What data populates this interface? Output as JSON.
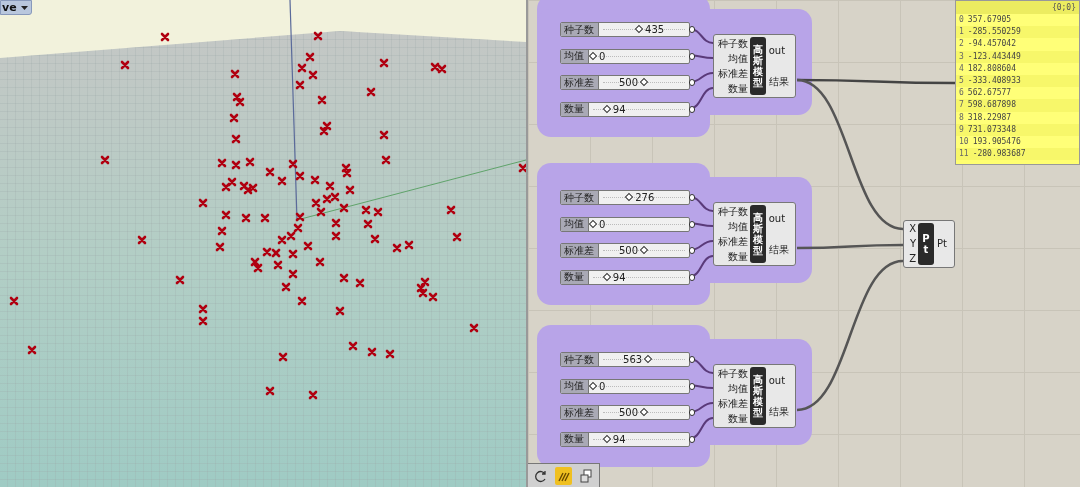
{
  "viewport": {
    "title": "ve"
  },
  "groups": [
    {
      "sliders": [
        {
          "label": "种子数",
          "value": "435",
          "level": 0.44
        },
        {
          "label": "均值",
          "value": "0",
          "level": 0
        },
        {
          "label": "标准差",
          "value": "500",
          "level": 0.5
        },
        {
          "label": "数量",
          "value": "94",
          "level": 0.15
        }
      ],
      "component": {
        "nickname": "高斯模型",
        "inputs": [
          "种子数",
          "均值",
          "标准差",
          "数量"
        ],
        "outputs": [
          "out",
          "结果"
        ]
      }
    },
    {
      "sliders": [
        {
          "label": "种子数",
          "value": "276",
          "level": 0.32
        },
        {
          "label": "均值",
          "value": "0",
          "level": 0
        },
        {
          "label": "标准差",
          "value": "500",
          "level": 0.5
        },
        {
          "label": "数量",
          "value": "94",
          "level": 0.15
        }
      ],
      "component": {
        "nickname": "高斯模型",
        "inputs": [
          "种子数",
          "均值",
          "标准差",
          "数量"
        ],
        "outputs": [
          "out",
          "结果"
        ]
      }
    },
    {
      "sliders": [
        {
          "label": "种子数",
          "value": "563",
          "level": 0.55
        },
        {
          "label": "均值",
          "value": "0",
          "level": 0
        },
        {
          "label": "标准差",
          "value": "500",
          "level": 0.5
        },
        {
          "label": "数量",
          "value": "94",
          "level": 0.15
        }
      ],
      "component": {
        "nickname": "高斯模型",
        "inputs": [
          "种子数",
          "均值",
          "标准差",
          "数量"
        ],
        "outputs": [
          "out",
          "结果"
        ]
      }
    }
  ],
  "point_component": {
    "nickname": "Pt",
    "inputs": [
      "X",
      "Y",
      "Z"
    ],
    "outputs": [
      "Pt"
    ]
  },
  "panel": {
    "header": "{0;0}",
    "rows": [
      {
        "index": "0",
        "value": "357.67905"
      },
      {
        "index": "1",
        "value": "-285.550259"
      },
      {
        "index": "2",
        "value": "-94.457042"
      },
      {
        "index": "3",
        "value": "-123.443449"
      },
      {
        "index": "4",
        "value": "182.808604"
      },
      {
        "index": "5",
        "value": "-333.408933"
      },
      {
        "index": "6",
        "value": "562.67577"
      },
      {
        "index": "7",
        "value": "598.687898"
      },
      {
        "index": "8",
        "value": "318.22987"
      },
      {
        "index": "9",
        "value": "731.073348"
      },
      {
        "index": "10",
        "value": "193.905476"
      },
      {
        "index": "11",
        "value": "-280.983687"
      }
    ]
  },
  "toolbar": {
    "items": [
      {
        "selected": false
      },
      {
        "selected": true
      },
      {
        "selected": false
      }
    ]
  }
}
